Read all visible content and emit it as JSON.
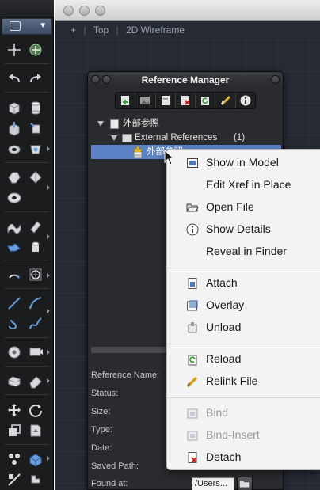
{
  "viewport": {
    "plus": "+",
    "view": "Top",
    "style": "2D Wireframe"
  },
  "ref_manager": {
    "title": "Reference Manager",
    "tree": {
      "root": "外部参照",
      "group_label": "External References",
      "group_count": "(1)",
      "item": "外部参照"
    },
    "item_badge": "DWG",
    "properties": {
      "reference_name": "Reference Name:",
      "status": "Status:",
      "size": "Size:",
      "type": "Type:",
      "date": "Date:",
      "saved_path": "Saved Path:",
      "found_at": "Found at:",
      "found_at_value": "/Users..."
    }
  },
  "context_menu": {
    "show_in_model": "Show in Model",
    "edit_xref": "Edit Xref in Place",
    "open_file": "Open File",
    "show_details": "Show Details",
    "reveal_in_finder": "Reveal in Finder",
    "attach": "Attach",
    "overlay": "Overlay",
    "unload": "Unload",
    "reload": "Reload",
    "relink_file": "Relink File",
    "bind": "Bind",
    "bind_insert": "Bind-Insert",
    "detach": "Detach"
  },
  "colors": {
    "palette_bg": "#1b1c1e",
    "viewport_bg": "#252a33",
    "selection": "#5a82c4",
    "menu_bg": "#f3f3f3"
  },
  "icons": {
    "palette": [
      "point-icon",
      "add-point-icon",
      "undo-icon",
      "redo-icon",
      "box-icon",
      "cylinder-icon",
      "extrude-icon",
      "revolve-icon",
      "sweep-icon",
      "loft-icon",
      "union-icon",
      "subtract-icon",
      "torus-icon",
      "surface-icon",
      "fillet-icon",
      "chamfer-icon",
      "arc-icon",
      "circle-icon",
      "line-icon",
      "polyline-icon",
      "spline-icon",
      "curve-icon",
      "orbit-icon",
      "camera-icon",
      "measure-icon",
      "eraser-icon",
      "move-icon",
      "rotate-icon",
      "scale-icon",
      "insert-icon",
      "array-icon",
      "block-icon",
      "trim-icon",
      "stretch-icon"
    ]
  }
}
